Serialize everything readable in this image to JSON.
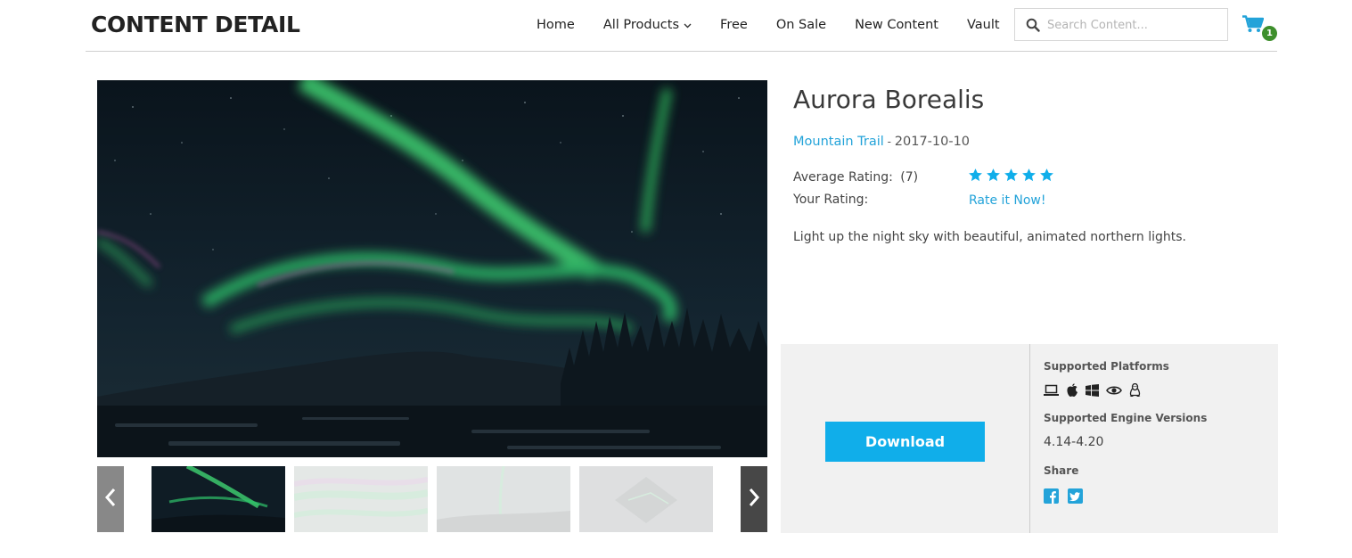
{
  "header": {
    "brand": "CONTENT DETAIL",
    "nav": [
      "Home",
      "All Products",
      "Free",
      "On Sale",
      "New Content",
      "Vault"
    ],
    "search_placeholder": "Search Content...",
    "cart_count": "1"
  },
  "product": {
    "title": "Aurora Borealis",
    "author": "Mountain Trail",
    "separator": " - ",
    "date": "2017-10-10",
    "average_rating_label": "Average Rating:",
    "rating_count": "(7)",
    "stars": 5,
    "your_rating_label": "Your Rating:",
    "rate_now": "Rate it Now!",
    "description": "Light up the night sky with beautiful, animated northern lights."
  },
  "panel": {
    "download_label": "Download",
    "platforms_label": "Supported Platforms",
    "platforms": [
      "windows-laptop-icon",
      "apple-icon",
      "windows-icon",
      "vr-eye-icon",
      "linux-icon"
    ],
    "engine_label": "Supported Engine Versions",
    "engine_versions": "4.14-4.20",
    "share_label": "Share",
    "share": [
      "facebook-icon",
      "twitter-icon"
    ]
  },
  "gallery": {
    "thumbnails": 4,
    "active_index": 0
  },
  "colors": {
    "accent": "#10aeea",
    "link": "#23a3d9",
    "badge": "#3e8f2c",
    "aurora": "#4ee07a"
  }
}
